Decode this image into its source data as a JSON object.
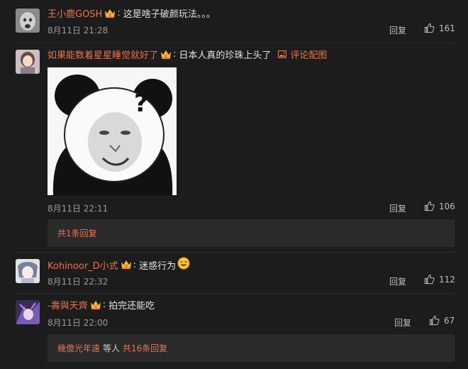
{
  "comments": [
    {
      "username": "王小鹿GOSH",
      "text": "这是啥子破颜玩法。。。",
      "time": "8月11日 21:28",
      "reply_label": "回复",
      "likes": "161"
    },
    {
      "username": "如果能数着星星睡觉就好了",
      "text": "日本人真的珍珠上头了",
      "pic_link": "评论配图",
      "time": "8月11日 22:11",
      "reply_label": "回复",
      "likes": "106",
      "replies_summary": "共1条回复"
    },
    {
      "username": "Kohinoor_D小式",
      "text": "迷惑行为",
      "time": "8月11日 22:32",
      "reply_label": "回复",
      "likes": "112"
    },
    {
      "username": "-壽與天齊",
      "text": "拍完还能吃",
      "time": "8月11日 22:00",
      "reply_label": "回复",
      "likes": "67",
      "replies_user": "幾億光年遠",
      "replies_mid": "等人",
      "replies_count": "共16条回复"
    }
  ],
  "colors": {
    "background": "#1c1c1c",
    "accent": "#eb7350",
    "bar": "#2a2a2a"
  },
  "icons": [
    "vip-crown-icon",
    "thumbs-up-icon",
    "image-icon",
    "smile-emoji-icon"
  ]
}
